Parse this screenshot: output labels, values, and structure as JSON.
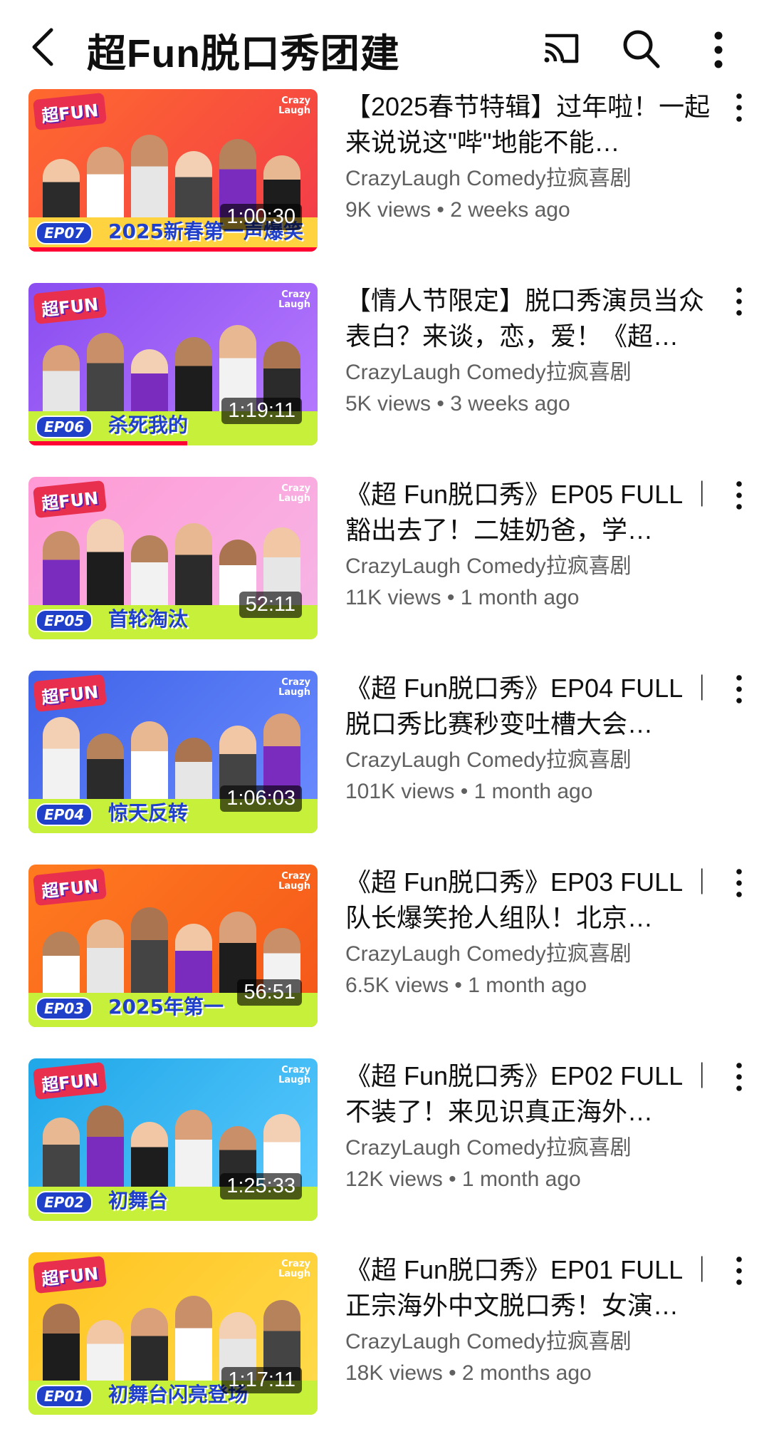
{
  "header": {
    "title": "超Fun脱口秀团建"
  },
  "colors": {
    "accent": "#ff0033",
    "secondary_text": "#606060"
  },
  "icons": {
    "back": "back-arrow-icon",
    "cast": "cast-icon",
    "search": "search-icon",
    "more": "more-vert-icon"
  },
  "videos": [
    {
      "title": "【2025春节特辑】过年啦！一起来说说这\"哔\"地能不能…",
      "channel": "CrazyLaugh Comedy拉疯喜剧",
      "views": "9K views",
      "age": "2 weeks ago",
      "duration": "1:00:30",
      "thumb_text": "2025新春第一声爆笑",
      "episode": "EP07",
      "watched_fraction": 1.0
    },
    {
      "title": "【情人节限定】脱口秀演员当众表白？来谈，恋，爱！《超…",
      "channel": "CrazyLaugh Comedy拉疯喜剧",
      "views": "5K views",
      "age": "3 weeks ago",
      "duration": "1:19:11",
      "thumb_text": "杀死我的",
      "episode": "EP06",
      "watched_fraction": 0.55
    },
    {
      "title": "《超 Fun脱口秀》EP05 FULL ｜豁出去了！二娃奶爸，学…",
      "channel": "CrazyLaugh Comedy拉疯喜剧",
      "views": "11K views",
      "age": "1 month ago",
      "duration": "52:11",
      "thumb_text": "首轮淘汰",
      "episode": "EP05",
      "watched_fraction": 0.0
    },
    {
      "title": "《超 Fun脱口秀》EP04 FULL ｜脱口秀比赛秒变吐槽大会…",
      "channel": "CrazyLaugh Comedy拉疯喜剧",
      "views": "101K views",
      "age": "1 month ago",
      "duration": "1:06:03",
      "thumb_text": "惊天反转",
      "episode": "EP04",
      "watched_fraction": 0.0
    },
    {
      "title": "《超 Fun脱口秀》EP03 FULL ｜队长爆笑抢人组队！北京…",
      "channel": "CrazyLaugh Comedy拉疯喜剧",
      "views": "6.5K views",
      "age": "1 month ago",
      "duration": "56:51",
      "thumb_text": "2025年第一",
      "episode": "EP03",
      "watched_fraction": 0.0
    },
    {
      "title": "《超 Fun脱口秀》EP02 FULL ｜不装了！来见识真正海外…",
      "channel": "CrazyLaugh Comedy拉疯喜剧",
      "views": "12K views",
      "age": "1 month ago",
      "duration": "1:25:33",
      "thumb_text": "初舞台",
      "episode": "EP02",
      "watched_fraction": 0.0
    },
    {
      "title": "《超 Fun脱口秀》EP01 FULL ｜正宗海外中文脱口秀！女演…",
      "channel": "CrazyLaugh Comedy拉疯喜剧",
      "views": "18K views",
      "age": "2 months ago",
      "duration": "1:17:11",
      "thumb_text": "初舞台闪亮登场",
      "episode": "EP01",
      "watched_fraction": 0.0
    }
  ]
}
